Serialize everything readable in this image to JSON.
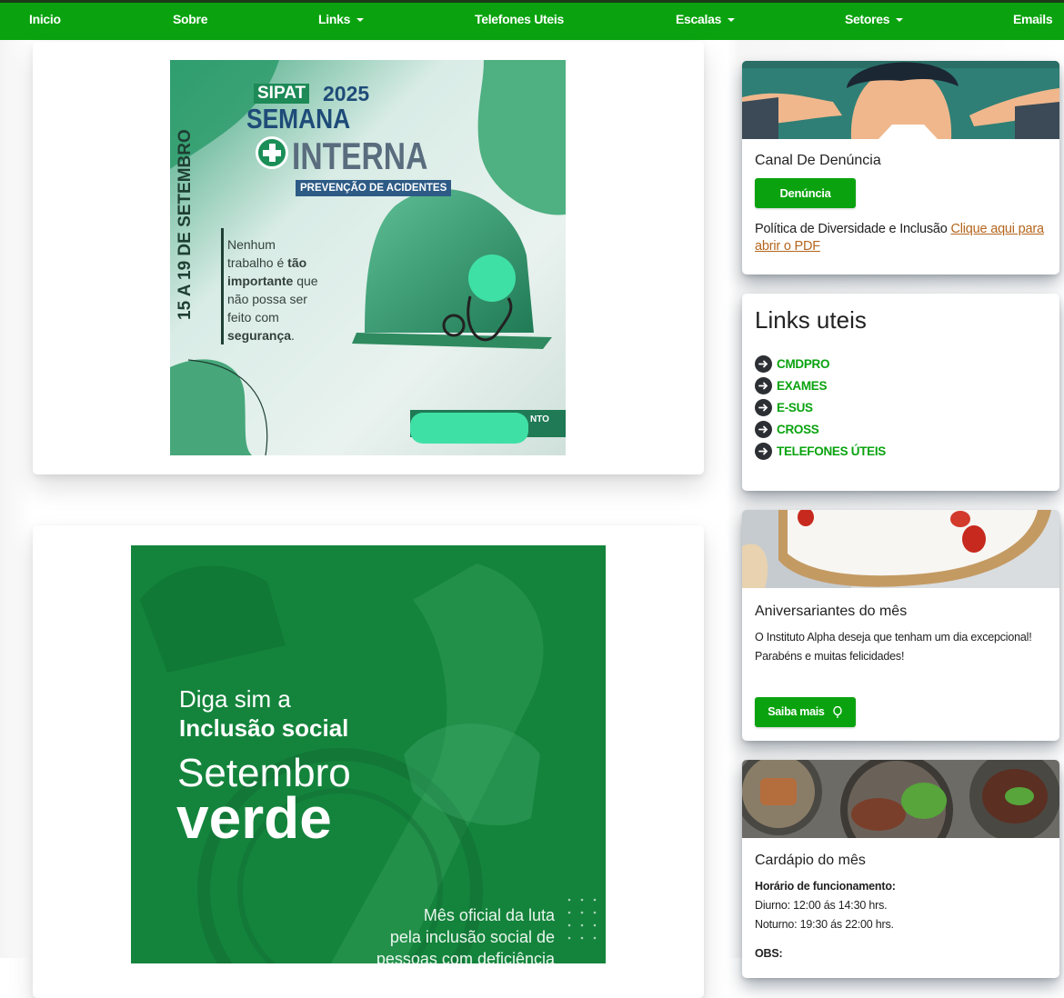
{
  "nav": {
    "items": [
      {
        "label": "Inicio"
      },
      {
        "label": "Sobre"
      },
      {
        "label": "Links"
      },
      {
        "label": "Telefones Uteis"
      },
      {
        "label": "Escalas"
      },
      {
        "label": "Setores"
      },
      {
        "label": "Emails"
      }
    ]
  },
  "sipat": {
    "tag": "SIPAT",
    "year": "2025",
    "line1": "SEMANA",
    "line2": "INTERNA",
    "ribbon": "PREVENÇÃO DE ACIDENTES",
    "dates": "15 A 19 DE SETEMBRO",
    "quote_1": "Nenhum",
    "quote_2a": "trabalho é ",
    "quote_2b": "tão",
    "quote_3a": "importante",
    "quote_3b": " que",
    "quote_4": "não possa ser",
    "quote_5": "feito com",
    "quote_6a": "segurança",
    "quote_6b": ".",
    "badge_text": "NTO"
  },
  "setembro": {
    "line1": "Diga sim a",
    "line2": "Inclusão social",
    "line3": "Setembro",
    "line4": "verde",
    "foot1": "Mês oficial da luta",
    "foot2": "pela inclusão social de",
    "foot3": "pessoas com deficiência"
  },
  "denuncia": {
    "title": "Canal De Denúncia",
    "button": "Denúncia",
    "policy_text": "Política de Diversidade e Inclusão ",
    "policy_link": "Clique aqui para abrir o PDF"
  },
  "links": {
    "title": "Links uteis",
    "items": [
      {
        "label": "CMDPRO"
      },
      {
        "label": "EXAMES"
      },
      {
        "label": "E-SUS"
      },
      {
        "label": "CROSS"
      },
      {
        "label": "TELEFONES ÚTEIS"
      }
    ]
  },
  "aniversariantes": {
    "title": "Aniversariantes do mês",
    "text1": "O Instituto Alpha deseja que tenham um dia excepcional!",
    "text2": "Parabéns e muitas felicidades!",
    "button": "Saiba mais"
  },
  "cardapio": {
    "title": "Cardápio do mês",
    "hours_label": "Horário de funcionamento:",
    "day": "Diurno: 12:00 ás 14:30 hrs.",
    "night": "Noturno: 19:30 ás 22:00 hrs.",
    "obs": "OBS:"
  },
  "colors": {
    "brand_green": "#0aa30f",
    "nav_border": "#1b3a18",
    "link_orange": "#b5651d"
  }
}
